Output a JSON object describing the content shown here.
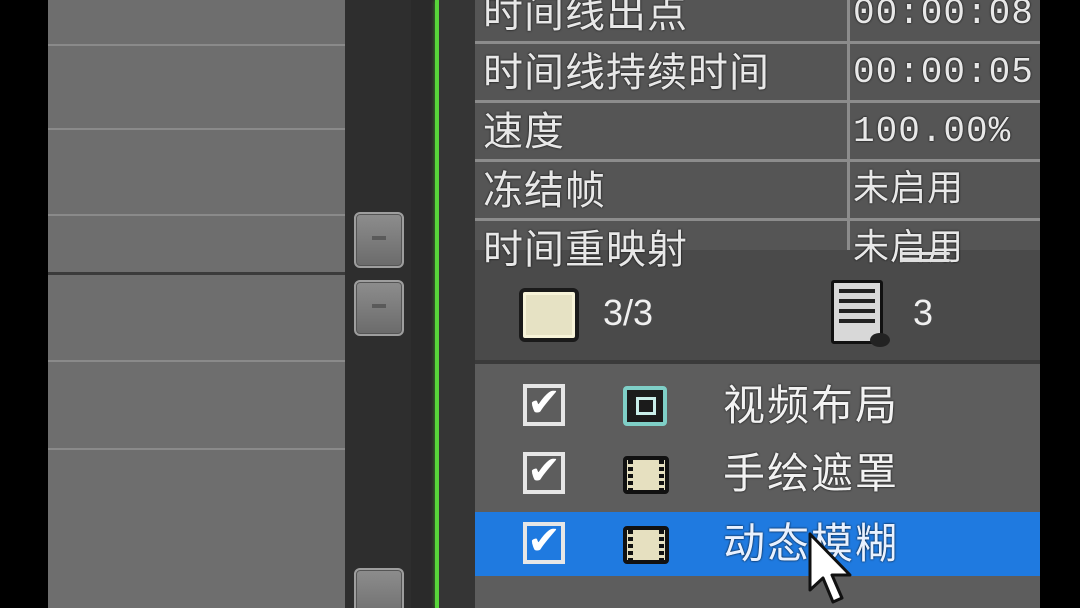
{
  "properties": {
    "rows": [
      {
        "name": "时间线出点",
        "value": "00:00:08:"
      },
      {
        "name": "时间线持续时间",
        "value": "00:00:05:"
      },
      {
        "name": "速度",
        "value": "100.00%"
      },
      {
        "name": "冻结帧",
        "value": "未启用"
      },
      {
        "name": "时间重映射",
        "value": "未启用"
      }
    ]
  },
  "counts": {
    "clips": "3/3",
    "effects": "3"
  },
  "effects_list": {
    "items": [
      {
        "label": "视频布局",
        "checked": "✔",
        "icon": "video-layout-icon"
      },
      {
        "label": "手绘遮罩",
        "checked": "✔",
        "icon": "film-icon"
      },
      {
        "label": "动态模糊",
        "checked": "✔",
        "icon": "film-icon",
        "selected": true
      }
    ]
  },
  "colors": {
    "selection": "#1f7ae0",
    "playhead": "#58d63a"
  }
}
